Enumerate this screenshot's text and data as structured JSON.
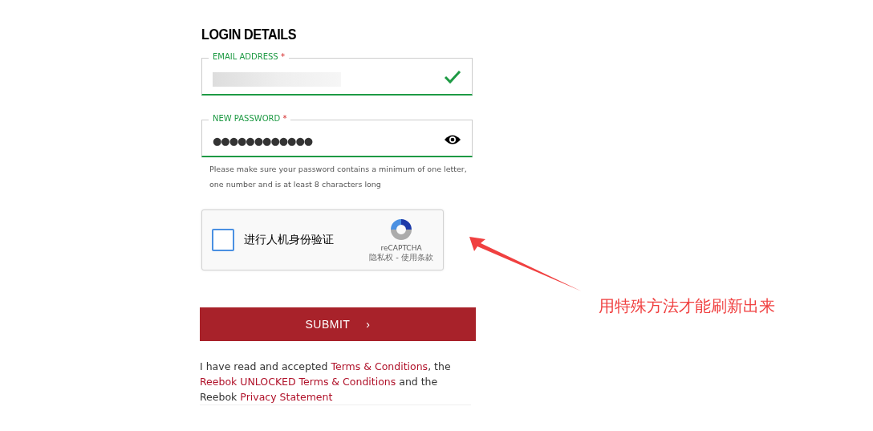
{
  "heading": "LOGIN DETAILS",
  "fields": [
    {
      "kind": "email",
      "label": "EMAIL ADDRESS",
      "required_mark": "*",
      "valid": true,
      "redacted": true
    },
    {
      "kind": "password",
      "label": "NEW PASSWORD",
      "required_mark": "*",
      "valid": true,
      "value": "●●●●●●●●●●●●"
    }
  ],
  "password_hint": "Please make sure your password contains a minimum of one letter, one number and is at least 8 characters long",
  "captcha": {
    "checked": false,
    "label": "进行人机身份验证",
    "brand": "reCAPTCHA",
    "links": "隐私权 - 使用条款"
  },
  "submit": {
    "label": "SUBMIT",
    "arrow": "›"
  },
  "terms": [
    {
      "kind": "text",
      "text": "I have read and accepted "
    },
    {
      "kind": "link",
      "text": "Terms & Conditions"
    },
    {
      "kind": "text",
      "text": ", the "
    },
    {
      "kind": "link",
      "text": "Reebok UNLOCKED Terms & Conditions"
    },
    {
      "kind": "text",
      "text": " and the Reebok "
    },
    {
      "kind": "link",
      "text": "Privacy Statement"
    }
  ],
  "annotation": "用特殊方法才能刷新出来"
}
